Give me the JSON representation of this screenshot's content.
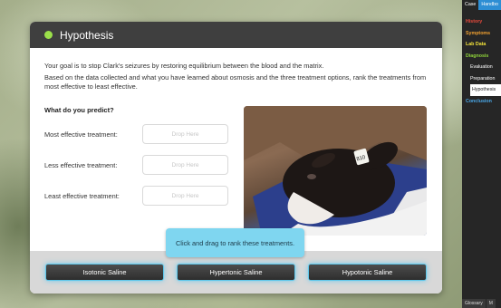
{
  "panel": {
    "title": "Hypothesis",
    "intro_line1": "Your goal is to stop Clark's seizures by restoring equilibrium between the blood and the matrix.",
    "intro_line2": "Based on the data collected and what you have learned about osmosis and the three treatment options, rank the treatments from most effective to least effective.",
    "predict_label": "What do you predict?",
    "rows": [
      {
        "label": "Most effective treatment:",
        "placeholder": "Drop Here"
      },
      {
        "label": "Less effective treatment:",
        "placeholder": "Drop Here"
      },
      {
        "label": "Least effective treatment:",
        "placeholder": "Drop Here"
      }
    ],
    "tooltip": "Click and drag to rank these treatments.",
    "treatments": [
      "Isotonic Saline",
      "Hypertonic Saline",
      "Hypotonic Saline"
    ],
    "photo_tag": "810"
  },
  "sidebar": {
    "tabs": [
      "Case",
      "Handbo"
    ],
    "nav": [
      {
        "label": "History",
        "color": "#e84a3c"
      },
      {
        "label": "Symptoms",
        "color": "#f0a030"
      },
      {
        "label": "Lab Data",
        "color": "#f2e23a"
      },
      {
        "label": "Diagnosis",
        "color": "#8fd33a"
      }
    ],
    "sub_items": [
      "Evaluation",
      "Preparation",
      "Hypothesis"
    ],
    "conclusion": {
      "label": "Conclusion",
      "color": "#4aa8e8"
    },
    "bottom_tabs": [
      "Glossary",
      "M"
    ]
  },
  "colors": {
    "accent": "#7fd6f0",
    "status_dot": "#9be04a"
  }
}
